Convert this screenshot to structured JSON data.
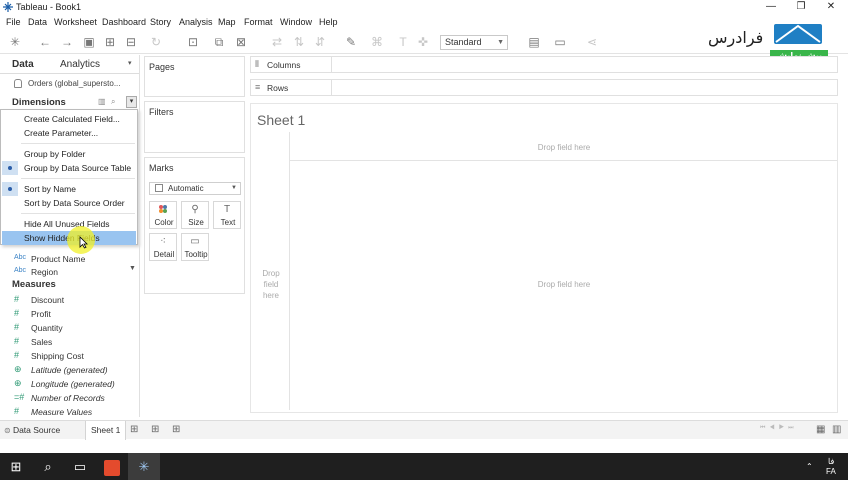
{
  "window": {
    "title": "Tableau - Book1",
    "minimize": "—",
    "restore": "❐",
    "close": "✕"
  },
  "menubar": [
    "File",
    "Data",
    "Worksheet",
    "Dashboard",
    "Story",
    "Analysis",
    "Map",
    "Format",
    "Window",
    "Help"
  ],
  "toolbar": {
    "fit_value": "Standard",
    "icons": [
      "tableau-logo-icon",
      "undo-icon",
      "redo-icon",
      "save-icon",
      "new-datasource-icon",
      "pause-updates-icon",
      "refresh-icon",
      "new-worksheet-icon",
      "duplicate-icon",
      "clear-icon",
      "swap-icon",
      "sort-ascending-icon",
      "sort-descending-icon",
      "highlight-icon",
      "group-icon",
      "label-icon",
      "fix-axes-icon",
      "show-cards-icon",
      "presentation-icon",
      "share-icon"
    ]
  },
  "logo": {
    "text": "فرادرس",
    "tagline": "پیش نمایش",
    "accent": "#39b54a",
    "blue": "#1f7fc4"
  },
  "data_pane": {
    "tabs": [
      "Data",
      "Analytics"
    ],
    "datasource": "Orders (global_supersto...",
    "dimensions_header": "Dimensions",
    "context_menu": [
      {
        "label": "Create Calculated Field...",
        "checked": false,
        "highlighted": false
      },
      {
        "label": "Create Parameter...",
        "checked": false,
        "highlighted": false
      },
      {
        "label": "Group by Folder",
        "checked": false,
        "highlighted": false
      },
      {
        "label": "Group by Data Source Table",
        "checked": true,
        "highlighted": false
      },
      {
        "label": "Sort by Name",
        "checked": true,
        "highlighted": false
      },
      {
        "label": "Sort by Data Source Order",
        "checked": false,
        "highlighted": false
      },
      {
        "label": "Hide All Unused Fields",
        "checked": false,
        "highlighted": false
      },
      {
        "label": "Show Hidden Fields",
        "checked": false,
        "highlighted": true
      }
    ],
    "dimension_fields": [
      {
        "type": "Abc",
        "name": "Product Name"
      },
      {
        "type": "Abc",
        "name": "Region"
      }
    ],
    "measures_header": "Measures",
    "measure_fields": [
      {
        "type": "#",
        "name": "Discount",
        "italic": false
      },
      {
        "type": "#",
        "name": "Profit",
        "italic": false
      },
      {
        "type": "#",
        "name": "Quantity",
        "italic": false
      },
      {
        "type": "#",
        "name": "Sales",
        "italic": false
      },
      {
        "type": "#",
        "name": "Shipping Cost",
        "italic": false
      },
      {
        "type": "globe",
        "name": "Latitude (generated)",
        "italic": true
      },
      {
        "type": "globe",
        "name": "Longitude (generated)",
        "italic": true
      },
      {
        "type": "=#",
        "name": "Number of Records",
        "italic": true
      },
      {
        "type": "#",
        "name": "Measure Values",
        "italic": true
      }
    ]
  },
  "cards": {
    "pages": "Pages",
    "filters": "Filters",
    "marks": "Marks",
    "mark_type": "Automatic",
    "mark_buttons": [
      "Color",
      "Size",
      "Text",
      "Detail",
      "Tooltip"
    ]
  },
  "shelves": {
    "columns": "Columns",
    "rows": "Rows"
  },
  "sheet": {
    "title": "Sheet 1",
    "drop_columns": "Drop field here",
    "drop_center": "Drop field here",
    "drop_rows": [
      "Drop",
      "field",
      "here"
    ]
  },
  "statusbar": {
    "datasource_tab": "Data Source",
    "sheet_tab": "Sheet 1"
  },
  "taskbar": {
    "lang": "FA",
    "clock": "فا"
  }
}
